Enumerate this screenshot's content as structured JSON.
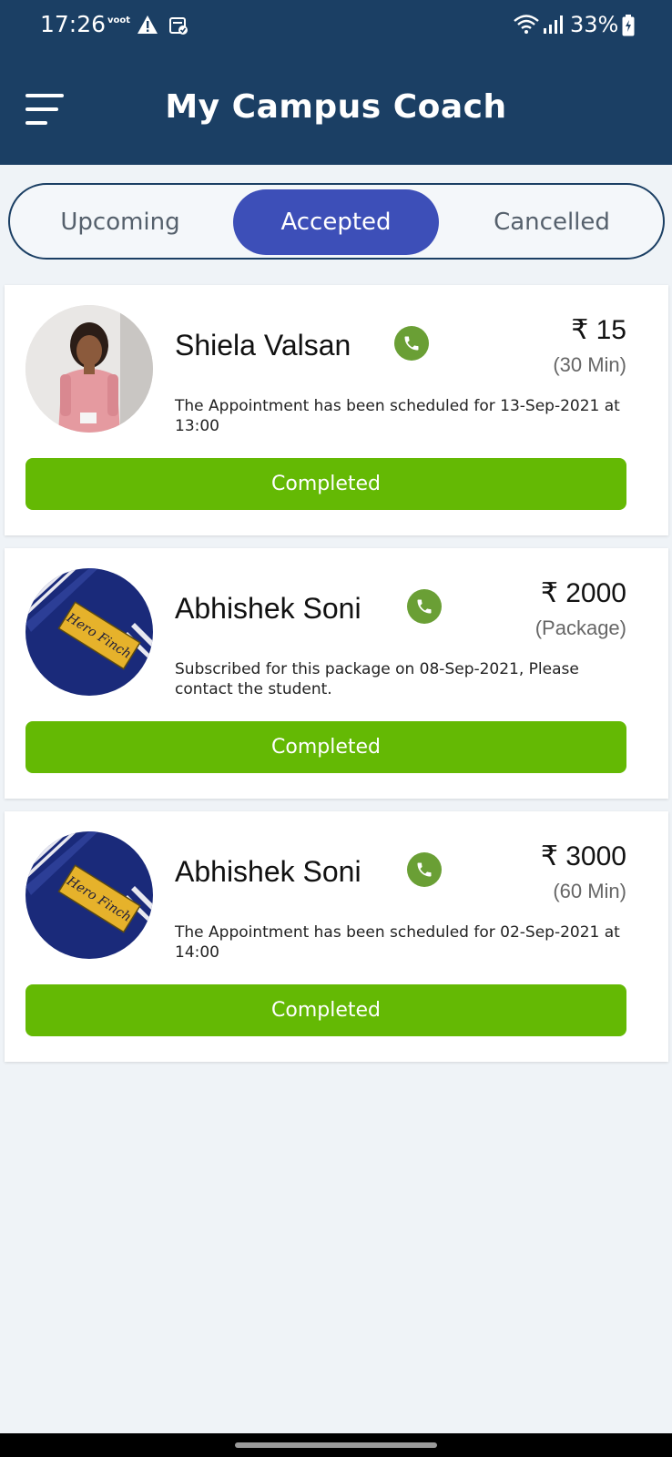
{
  "status_bar": {
    "time": "17:26",
    "voot_badge": "voot",
    "battery": "33%",
    "icons": [
      "voot-icon",
      "warning-icon",
      "calendar-check-icon",
      "wifi-icon",
      "signal-icon",
      "battery-charging-icon"
    ]
  },
  "header": {
    "title": "My Campus Coach",
    "menu_icon": "hamburger-menu-icon",
    "background": "#1b3f64"
  },
  "tabs": [
    {
      "label": "Upcoming",
      "active": false
    },
    {
      "label": "Accepted",
      "active": true
    },
    {
      "label": "Cancelled",
      "active": false
    }
  ],
  "appointments": [
    {
      "name": "Shiela Valsan",
      "price": "₹ 15",
      "price_detail": "(30 Min)",
      "message": "The Appointment has been scheduled for 13-Sep-2021 at 13:00",
      "status": "Completed"
    },
    {
      "name": "Abhishek Soni",
      "price": "₹ 2000",
      "price_detail": "(Package)",
      "message": "Subscribed for this package on 08-Sep-2021, Please contact the student.",
      "status": "Completed"
    },
    {
      "name": "Abhishek Soni",
      "price": "₹ 3000",
      "price_detail": "(60 Min)",
      "message": "The Appointment has been scheduled for 02-Sep-2021 at 14:00",
      "status": "Completed"
    }
  ],
  "avatar_label": {
    "brand": "Hero Finch"
  },
  "colors": {
    "accent_tab": "#3d4fb8",
    "completed_button": "#64b904",
    "phone_icon": "#6a9f35"
  }
}
